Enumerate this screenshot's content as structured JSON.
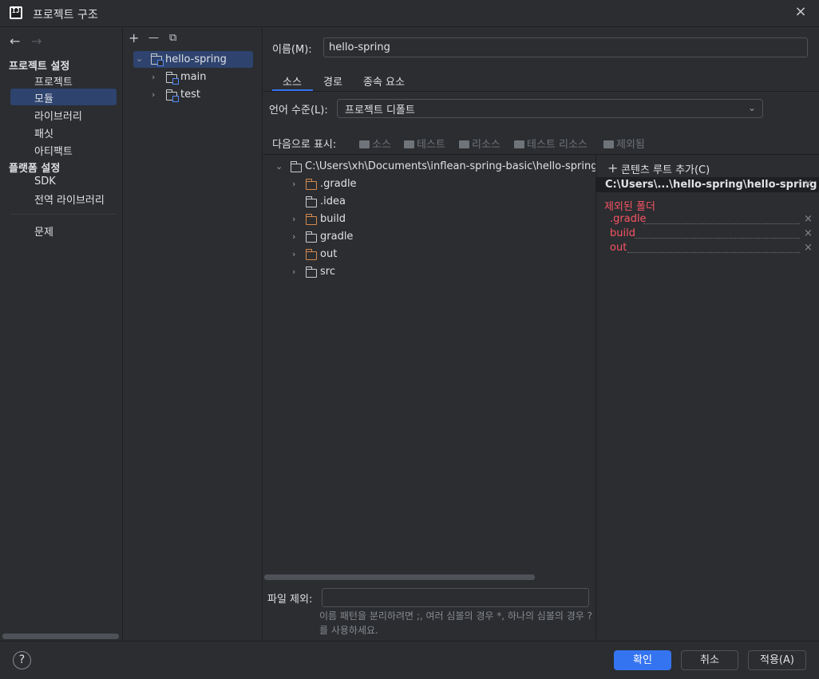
{
  "window": {
    "title": "프로젝트 구조",
    "app_icon_text": "IJ"
  },
  "nav": {
    "back": "←",
    "forward": "→",
    "section_project": "프로젝트 설정",
    "project": "프로젝트",
    "modules": "모듈",
    "libraries": "라이브러리",
    "facets": "패싯",
    "artifacts": "아티팩트",
    "section_platform": "플랫폼 설정",
    "sdk": "SDK",
    "global_libraries": "전역 라이브러리",
    "problems": "문제"
  },
  "module_tree": {
    "add": "+",
    "remove": "—",
    "copy": "⧉",
    "root": "hello-spring",
    "children": [
      "main",
      "test"
    ]
  },
  "module": {
    "name_label": "이름(M):",
    "name_value": "hello-spring",
    "tabs": [
      "소스",
      "경로",
      "종속 요소"
    ],
    "language_label": "언어 수준(L):",
    "language_value": "프로젝트 디폴트",
    "mark_as_label": "다음으로 표시:",
    "mark_buttons": [
      "소스",
      "테스트",
      "리소스",
      "테스트 리소스",
      "제외됨"
    ],
    "root_path": "C:\\Users\\xh\\Documents\\inflean-spring-basic\\hello-spring\\",
    "folders": [
      {
        "name": ".gradle",
        "excluded": true,
        "expandable": true
      },
      {
        "name": ".idea",
        "excluded": false,
        "expandable": false
      },
      {
        "name": "build",
        "excluded": true,
        "expandable": true
      },
      {
        "name": "gradle",
        "excluded": false,
        "expandable": true
      },
      {
        "name": "out",
        "excluded": true,
        "expandable": true
      },
      {
        "name": "src",
        "excluded": false,
        "expandable": true
      }
    ],
    "exclude_files_label": "파일 제외:",
    "exclude_files_value": "",
    "exclude_hint": "이름 패턴을 분리하려면 ;, 여러 심볼의 경우 *, 하나의 심볼의 경우 ?를 사용하세요."
  },
  "content_root": {
    "add_label": "콘텐츠 루트 추가(C)",
    "path": "C:\\Users\\...\\hello-spring\\hello-spring",
    "excluded_title": "제외된 폴더",
    "excluded": [
      ".gradle",
      "build",
      "out"
    ],
    "remove_glyph": "×"
  },
  "footer": {
    "help": "?",
    "ok": "확인",
    "cancel": "취소",
    "apply": "적용(A)"
  },
  "colors": {
    "background": "#2b2d30",
    "selection": "#2e436e",
    "accent": "#3574f0",
    "excluded": "#f75464",
    "excluded_folder": "#d68a4f"
  }
}
